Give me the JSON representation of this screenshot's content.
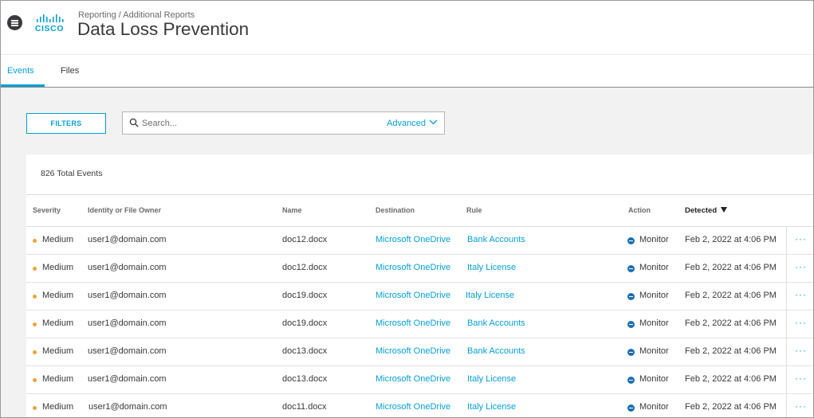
{
  "header": {
    "breadcrumb": "Reporting / Additional Reports",
    "title": "Data Loss Prevention",
    "logo_text": "CISCO"
  },
  "tabs": [
    {
      "label": "Events",
      "active": true
    },
    {
      "label": "Files",
      "active": false
    }
  ],
  "toolbar": {
    "filters_label": "FILTERS",
    "search_placeholder": "Search...",
    "advanced_label": "Advanced"
  },
  "table": {
    "total_label": "826 Total Events",
    "columns": [
      "Severity",
      "Identity or File Owner",
      "Name",
      "Destination",
      "Rule",
      "Action",
      "Detected"
    ],
    "sort_column": "Detected",
    "rows": [
      {
        "severity": "Medium",
        "owner": "user1@domain.com",
        "name": "doc12.docx",
        "destination": "Microsoft OneDrive",
        "rule": "Bank Accounts",
        "action": "Monitor",
        "detected": "Feb 2, 2022 at 4:06 PM"
      },
      {
        "severity": "Medium",
        "owner": "user1@domain.com",
        "name": "doc12.docx",
        "destination": "Microsoft OneDrive",
        "rule": "Italy License",
        "action": "Monitor",
        "detected": "Feb 2, 2022 at 4:06 PM"
      },
      {
        "severity": "Medium",
        "owner": "user1@domain.com",
        "name": "doc19.docx",
        "destination": "Microsoft OneDrive",
        "rule": "Italy License",
        "action": "Monitor",
        "detected": "Feb 2, 2022 at 4:06 PM"
      },
      {
        "severity": "Medium",
        "owner": "user1@domain.com",
        "name": "doc19.docx",
        "destination": "Microsoft OneDrive",
        "rule": "Bank Accounts",
        "action": "Monitor",
        "detected": "Feb 2, 2022 at 4:06 PM"
      },
      {
        "severity": "Medium",
        "owner": "user1@domain.com",
        "name": "doc13.docx",
        "destination": "Microsoft OneDrive",
        "rule": "Bank Accounts",
        "action": "Monitor",
        "detected": "Feb 2, 2022 at 4:06 PM"
      },
      {
        "severity": "Medium",
        "owner": "user1@domain.com",
        "name": "doc13.docx",
        "destination": "Microsoft OneDrive",
        "rule": "Italy License",
        "action": "Monitor",
        "detected": "Feb 2, 2022 at 4:06 PM"
      },
      {
        "severity": "Medium",
        "owner": "user1@domain.com",
        "name": "doc11.docx",
        "destination": "Microsoft OneDrive",
        "rule": "Italy License",
        "action": "Monitor",
        "detected": "Feb 2, 2022 at 4:06 PM"
      }
    ],
    "more_glyph": "···"
  },
  "colors": {
    "accent": "#049fd9",
    "severity_medium": "#f0a23b",
    "monitor_icon": "#1e6fb5"
  },
  "icons": [
    "menu-icon",
    "cisco-logo",
    "search-icon",
    "chevron-down-icon",
    "severity-dot-icon",
    "monitor-icon",
    "more-options-icon",
    "sort-desc-icon"
  ]
}
